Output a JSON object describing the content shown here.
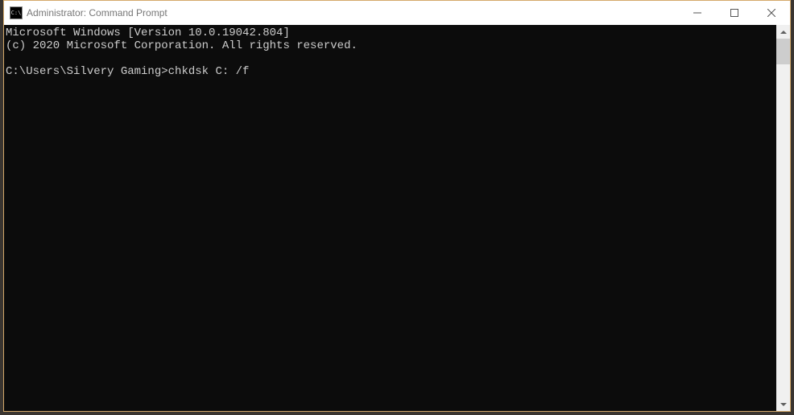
{
  "titlebar": {
    "icon_label": "C:\\",
    "title": "Administrator: Command Prompt"
  },
  "terminal": {
    "line1": "Microsoft Windows [Version 10.0.19042.804]",
    "line2": "(c) 2020 Microsoft Corporation. All rights reserved.",
    "blank": "",
    "prompt": "C:\\Users\\Silvery Gaming>",
    "command": "chkdsk C: /f"
  }
}
